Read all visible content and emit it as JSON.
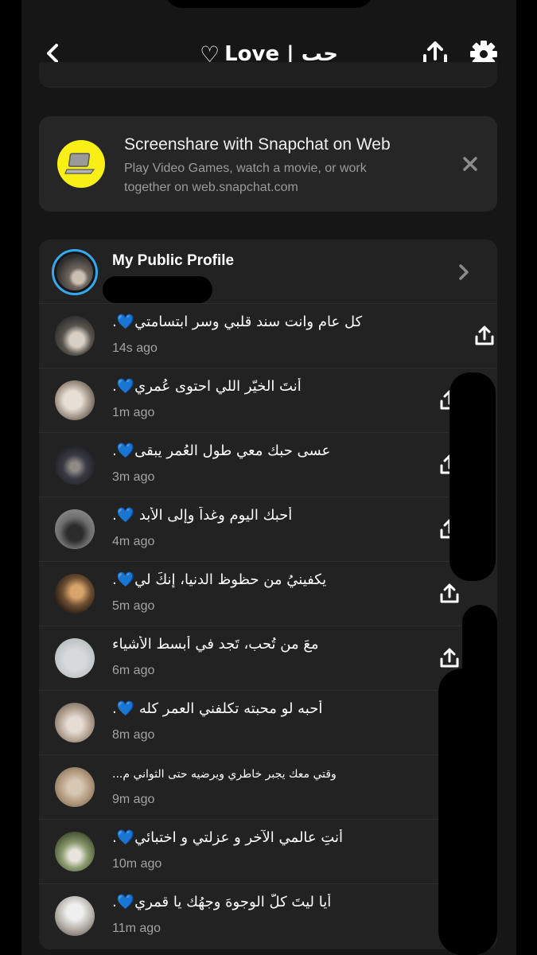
{
  "header": {
    "title_heart": "♡",
    "title_text": "Love | حب"
  },
  "banner": {
    "title": "Screenshare with Snapchat on Web",
    "subtitle_line1": "Play Video Games, watch a movie, or work",
    "subtitle_line2": "together on web.snapchat.com"
  },
  "profile": {
    "label": "My Public Profile"
  },
  "stories": [
    {
      "caption": "كل عام وانت سند قلبي وسر ابتسامتي💙.",
      "time": "14s ago",
      "thumb": "hands"
    },
    {
      "caption": "أنتَ الخيّر اللي احتوى عُمري💙.",
      "time": "1m ago",
      "thumb": "hands-light"
    },
    {
      "caption": "عسى حبك معي طول العُمر يبقى💙.",
      "time": "3m ago",
      "thumb": "dark-hands"
    },
    {
      "caption": "أحبك اليوم وغداً وإلى الأبد 💙.",
      "time": "4m ago",
      "thumb": "couple-gray"
    },
    {
      "caption": "يكفينيُ من حظوظ الدنيا، إنكَ لي💙.",
      "time": "5m ago",
      "thumb": "sunset"
    },
    {
      "caption": "معَ من تُحب، تَجد في أبسط الأشياء",
      "time": "6m ago",
      "thumb": "pale"
    },
    {
      "caption": "أحبه لو محبته تكلفني العمر كله 💙.",
      "time": "8m ago",
      "thumb": "watch"
    },
    {
      "caption": "وقتي معك يجبر خاطري ويرضيه حتى الثواني م...",
      "time": "9m ago",
      "thumb": "text-photo",
      "small": true
    },
    {
      "caption": "أنتِ عالمي الآخر و عزلتي و اختبائي💙.",
      "time": "10m ago",
      "thumb": "flowers"
    },
    {
      "caption": "أيا ليتَ كلَّ الوجوهَ وجهُك يا قمري💙.",
      "time": "11m ago",
      "thumb": "cap"
    }
  ],
  "colors": {
    "background": "#161616",
    "card": "#262626",
    "list_card": "#222222",
    "snap_yellow": "#f8ef16",
    "profile_ring": "#35a9f0",
    "secondary_text": "#a3a3a3"
  }
}
